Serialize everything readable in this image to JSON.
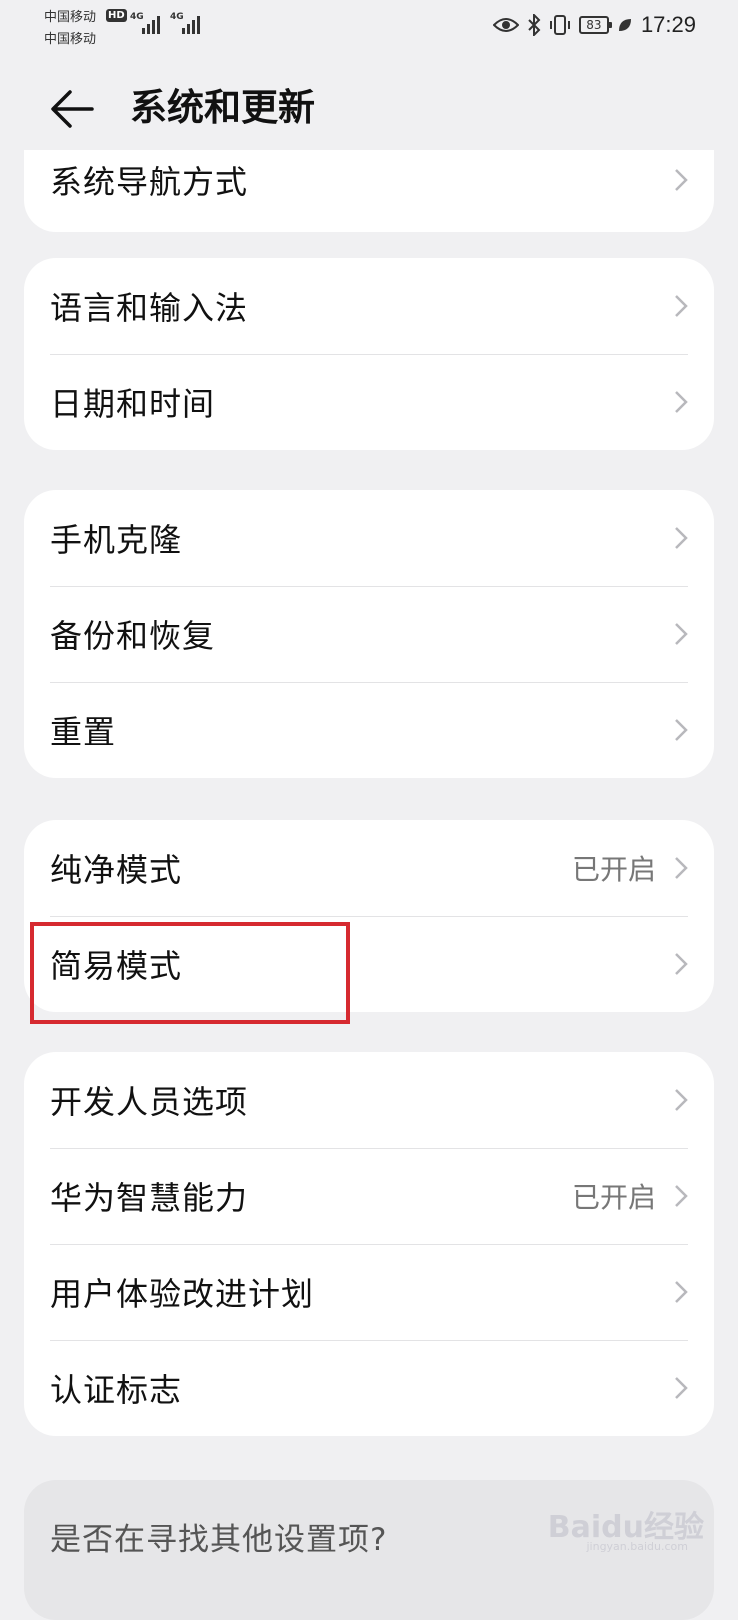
{
  "status": {
    "carrier1": "中国移动",
    "carrier2": "中国移动",
    "hd": "HD",
    "net1": "4G",
    "net2": "4G",
    "battery": "83",
    "time": "17:29"
  },
  "header": {
    "title": "系统和更新"
  },
  "cards": [
    {
      "rows": [
        {
          "label": "系统导航方式",
          "value": ""
        }
      ]
    },
    {
      "rows": [
        {
          "label": "语言和输入法",
          "value": ""
        },
        {
          "label": "日期和时间",
          "value": ""
        }
      ]
    },
    {
      "rows": [
        {
          "label": "手机克隆",
          "value": ""
        },
        {
          "label": "备份和恢复",
          "value": ""
        },
        {
          "label": "重置",
          "value": ""
        }
      ]
    },
    {
      "rows": [
        {
          "label": "纯净模式",
          "value": "已开启"
        },
        {
          "label": "简易模式",
          "value": ""
        }
      ]
    },
    {
      "rows": [
        {
          "label": "开发人员选项",
          "value": ""
        },
        {
          "label": "华为智慧能力",
          "value": "已开启"
        },
        {
          "label": "用户体验改进计划",
          "value": ""
        },
        {
          "label": "认证标志",
          "value": ""
        }
      ]
    }
  ],
  "search_prompt": "是否在寻找其他设置项?",
  "watermark": "Baidu经验",
  "watermark_sub": "jingyan.baidu.com",
  "colors": {
    "highlight": "#d62a30",
    "background": "#f0f0f2"
  }
}
